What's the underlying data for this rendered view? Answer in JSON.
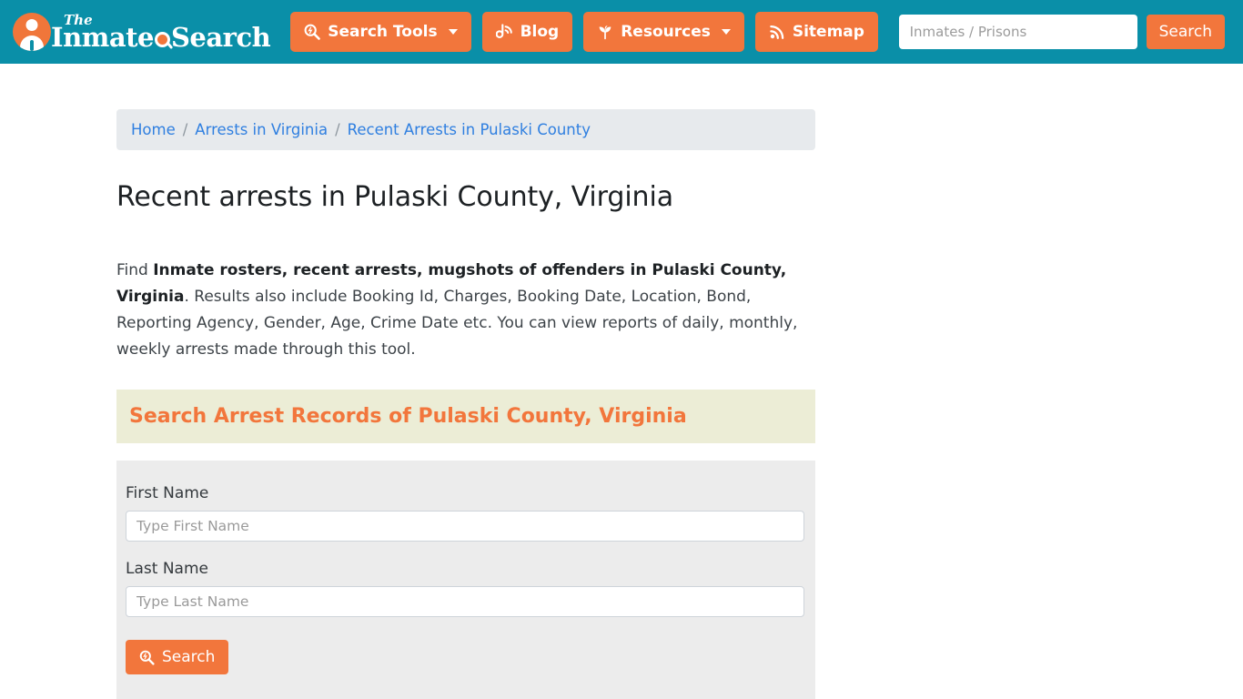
{
  "header": {
    "logo": {
      "the": "The",
      "main_pre": "Inmate",
      "main_post": "Search"
    },
    "nav": [
      {
        "label": "Search Tools",
        "icon": "search-tools-icon",
        "has_caret": true
      },
      {
        "label": "Blog",
        "icon": "blog-icon",
        "has_caret": false
      },
      {
        "label": "Resources",
        "icon": "resources-icon",
        "has_caret": true
      },
      {
        "label": "Sitemap",
        "icon": "rss-icon",
        "has_caret": false
      }
    ],
    "search": {
      "placeholder": "Inmates / Prisons",
      "value": "",
      "button_label": "Search"
    }
  },
  "breadcrumb": {
    "items": [
      "Home",
      "Arrests in Virginia",
      "Recent Arrests in Pulaski County"
    ],
    "separator": "/"
  },
  "main": {
    "title": "Recent arrests in Pulaski County, Virginia",
    "intro": {
      "lead": "Find ",
      "bold": "Inmate rosters, recent arrests, mugshots of offenders in Pulaski County, Virginia",
      "rest": ". Results also include Booking Id, Charges, Booking Date, Location, Bond, Reporting Agency, Gender, Age, Crime Date etc. You can view reports of daily, monthly, weekly arrests made through this tool."
    },
    "panel_heading": "Search Arrest Records of Pulaski County, Virginia",
    "form": {
      "first_name": {
        "label": "First Name",
        "placeholder": "Type First Name",
        "value": ""
      },
      "last_name": {
        "label": "Last Name",
        "placeholder": "Type Last Name",
        "value": ""
      },
      "submit_label": "Search"
    }
  },
  "colors": {
    "header_teal": "#0a8fa8",
    "accent_orange": "#f2763c",
    "panel_beige": "#ecedd6",
    "form_gray": "#ececec",
    "breadcrumb_gray": "#e7eaed",
    "link_blue": "#2f7fe0"
  }
}
